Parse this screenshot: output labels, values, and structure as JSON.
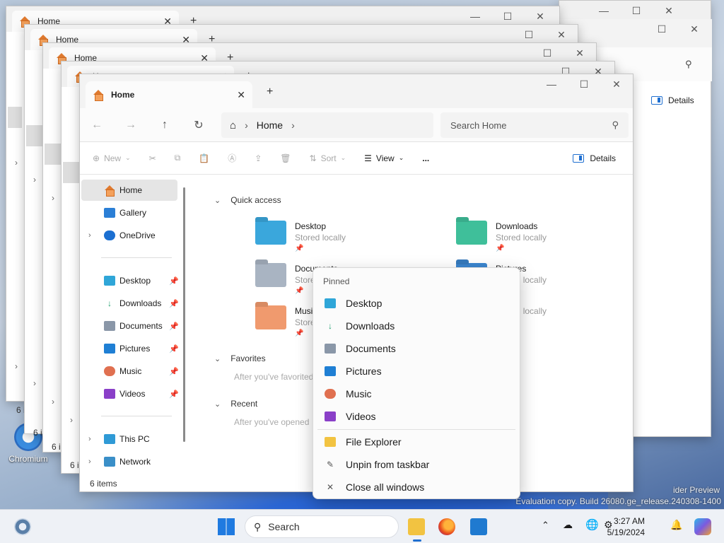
{
  "stacked_windows": {
    "tab_title": "Home",
    "details_label": "Details",
    "items_label_partial": "6 i"
  },
  "main_window": {
    "tab_title": "Home",
    "breadcrumb": {
      "segment": "Home"
    },
    "search_placeholder": "Search Home",
    "toolbar": {
      "new_label": "New",
      "sort_label": "Sort",
      "view_label": "View",
      "more_label": "...",
      "details_label": "Details"
    },
    "sidebar": {
      "items": [
        {
          "label": "Home",
          "icon": "home-icon"
        },
        {
          "label": "Gallery",
          "icon": "gallery-icon"
        },
        {
          "label": "OneDrive",
          "icon": "onedrive-icon"
        },
        {
          "label": "Desktop",
          "icon": "desktop-folder-icon"
        },
        {
          "label": "Downloads",
          "icon": "downloads-icon"
        },
        {
          "label": "Documents",
          "icon": "documents-icon"
        },
        {
          "label": "Pictures",
          "icon": "pictures-icon"
        },
        {
          "label": "Music",
          "icon": "music-icon"
        },
        {
          "label": "Videos",
          "icon": "videos-icon"
        },
        {
          "label": "This PC",
          "icon": "pc-icon"
        },
        {
          "label": "Network",
          "icon": "network-icon"
        }
      ]
    },
    "content": {
      "quick_access_title": "Quick access",
      "quick_access": [
        {
          "name": "Desktop",
          "sub": "Stored locally"
        },
        {
          "name": "Downloads",
          "sub": "Stored locally"
        },
        {
          "name": "Documents",
          "sub": "Store"
        },
        {
          "name": "Pictures",
          "sub": "Stored locally"
        },
        {
          "name": "Musi",
          "sub": "Store"
        },
        {
          "name": "",
          "sub": "Stored locally"
        }
      ],
      "favorites_title": "Favorites",
      "favorites_hint": "After you've favorited",
      "recent_title": "Recent",
      "recent_hint": "After you've opened"
    },
    "status": "6 items"
  },
  "jump_list": {
    "header": "Pinned",
    "items": [
      {
        "label": "Desktop",
        "icon": "desktop-folder-icon"
      },
      {
        "label": "Downloads",
        "icon": "downloads-icon"
      },
      {
        "label": "Documents",
        "icon": "documents-icon"
      },
      {
        "label": "Pictures",
        "icon": "pictures-icon"
      },
      {
        "label": "Music",
        "icon": "music-icon"
      },
      {
        "label": "Videos",
        "icon": "videos-icon"
      }
    ],
    "actions": [
      {
        "label": "File Explorer",
        "icon": "file-explorer-icon"
      },
      {
        "label": "Unpin from taskbar",
        "icon": "unpin-icon"
      },
      {
        "label": "Close all windows",
        "icon": "close-icon"
      }
    ]
  },
  "desktop": {
    "chromium_label": "Chromium",
    "watermark_line1": "ider Preview",
    "watermark_line2": "Evaluation copy. Build 26080.ge_release.240308-1400"
  },
  "taskbar": {
    "search_label": "Search",
    "time": "3:27 AM",
    "date": "5/19/2024"
  }
}
